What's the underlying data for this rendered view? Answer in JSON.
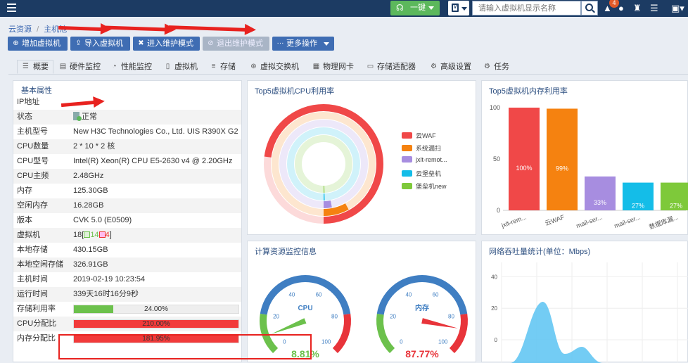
{
  "topbar": {
    "one_click_label": "一键",
    "search_placeholder": "请输入虚拟机显示名称",
    "alert_count": "4"
  },
  "breadcrumb": {
    "root": "云资源",
    "sep": "/",
    "next": "主机池"
  },
  "actions": {
    "add_vm": "增加虚拟机",
    "import_vm": "导入虚拟机",
    "enter_maintenance": "进入维护模式",
    "exit_maintenance": "退出维护模式",
    "more": "更多操作"
  },
  "tabs": [
    "概要",
    "硬件监控",
    "性能监控",
    "虚拟机",
    "存储",
    "虚拟交换机",
    "物理网卡",
    "存储适配器",
    "高级设置",
    "任务"
  ],
  "properties": {
    "title": "基本属性",
    "rows": [
      {
        "k": "IP地址",
        "v": ""
      },
      {
        "k": "状态",
        "v": "正常"
      },
      {
        "k": "主机型号",
        "v": "New H3C Technologies Co., Ltd. UIS R390X G2"
      },
      {
        "k": "CPU数量",
        "v": "2 * 10 * 2 核"
      },
      {
        "k": "CPU型号",
        "v": "Intel(R) Xeon(R) CPU E5-2630 v4 @ 2.20GHz"
      },
      {
        "k": "CPU主频",
        "v": "2.48GHz"
      },
      {
        "k": "内存",
        "v": "125.30GB"
      },
      {
        "k": "空闲内存",
        "v": "16.28GB"
      },
      {
        "k": "版本",
        "v": "CVK 5.0 (E0509)"
      },
      {
        "k": "虚拟机",
        "v": "18"
      },
      {
        "k": "本地存储",
        "v": "430.15GB"
      },
      {
        "k": "本地空闲存储",
        "v": "326.91GB"
      },
      {
        "k": "主机时间",
        "v": "2019-02-19 10:23:54"
      },
      {
        "k": "运行时间",
        "v": "339天16时16分9秒"
      },
      {
        "k": "存储利用率",
        "v": "24.00%"
      },
      {
        "k": "CPU分配比",
        "v": "210.00%"
      },
      {
        "k": "内存分配比",
        "v": "181.95%"
      }
    ],
    "vm_running": "14",
    "vm_stopped": "4",
    "storage_pct": 0.24,
    "colors": {
      "ok": "#6cc14c",
      "bad": "#f23a3a"
    }
  },
  "panels": {
    "cpu_top5_title": "Top5虚拟机CPU利用率",
    "mem_top5_title": "Top5虚拟机内存利用率",
    "monitor_title": "计算资源监控信息",
    "net_title": "网络吞吐量统计(单位：Mbps)"
  },
  "chart_data": [
    {
      "type": "pie",
      "title": "Top5虚拟机CPU利用率",
      "legend": [
        "云WAF",
        "系统漏扫",
        "jxlt-remot...",
        "云堡垒机",
        "堡垒机new"
      ],
      "colors": [
        "#f04848",
        "#f58210",
        "#a78de0",
        "#14bde8",
        "#7ec93a"
      ],
      "values": [
        73,
        8,
        3,
        0.5,
        0.5
      ]
    },
    {
      "type": "bar",
      "title": "Top5虚拟机内存利用率",
      "categories": [
        "jxlt-rem...",
        "云WAF",
        "mail-ser...",
        "mail-ser...",
        "数据库漏..."
      ],
      "values": [
        100,
        99,
        33,
        27,
        27
      ],
      "labels": [
        "100%",
        "99%",
        "33%",
        "27%",
        "27%"
      ],
      "colors": [
        "#f04848",
        "#f58210",
        "#a78de0",
        "#14bde8",
        "#7ec93a"
      ],
      "yticks": [
        "0",
        "50",
        "100"
      ],
      "ylim": [
        0,
        100
      ]
    },
    {
      "type": "gauge",
      "items": [
        {
          "label": "CPU",
          "value": 8.81,
          "display": "8.81%",
          "color": "#6cc14c"
        },
        {
          "label": "内存",
          "value": 87.77,
          "display": "87.77%",
          "color": "#e8343a"
        }
      ],
      "ticks": [
        "0",
        "20",
        "40",
        "60",
        "80",
        "100"
      ]
    },
    {
      "type": "area",
      "title": "网络吞吐量统计(单位：Mbps)",
      "yticks": [
        "0",
        "20",
        "40"
      ],
      "ylim": [
        0,
        50
      ],
      "color": "#5bc3f2"
    }
  ]
}
